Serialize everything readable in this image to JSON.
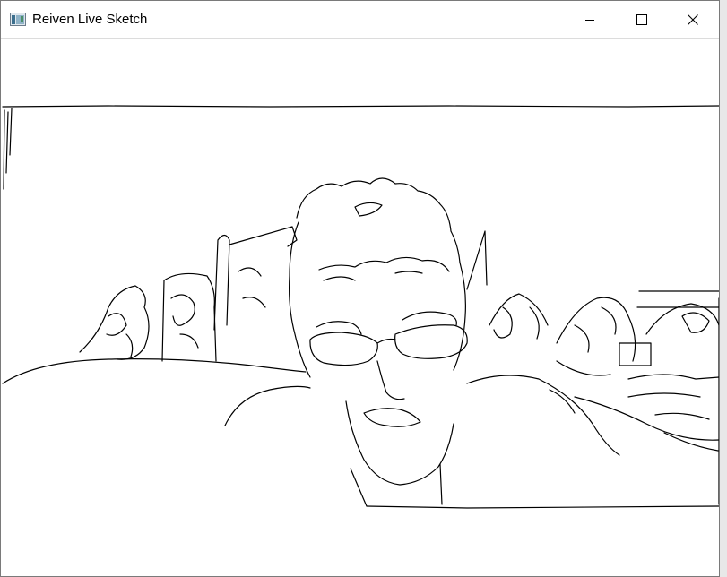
{
  "window": {
    "title": "Reiven Live Sketch",
    "app_icon": "app-window-icon",
    "buttons": {
      "minimize": "minimize-icon",
      "maximize": "maximize-icon",
      "close": "close-icon"
    }
  },
  "canvas": {
    "content": "edge-detected webcam sketch",
    "background_color": "#ffffff",
    "stroke_color": "#000000"
  }
}
